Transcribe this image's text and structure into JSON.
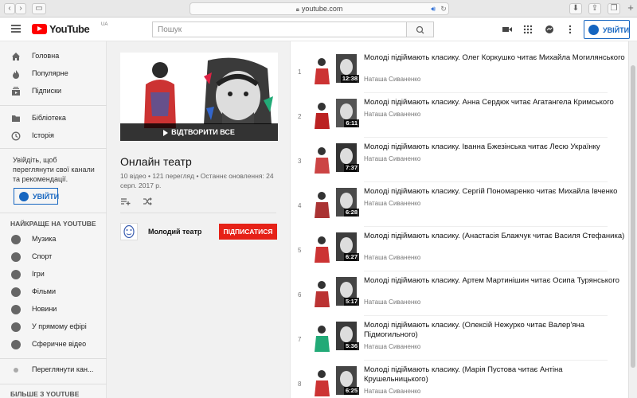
{
  "browser": {
    "url": "youtube.com",
    "new_tab": "+"
  },
  "masthead": {
    "logo_text": "YouTube",
    "logo_region": "UA",
    "search_placeholder": "Пошук",
    "signin_label": "УВІЙТИ"
  },
  "sidebar": {
    "primary": [
      {
        "label": "Головна",
        "icon": "home-icon"
      },
      {
        "label": "Популярне",
        "icon": "flame-icon"
      },
      {
        "label": "Підписки",
        "icon": "subscriptions-icon"
      }
    ],
    "library": [
      {
        "label": "Бібліотека",
        "icon": "folder-icon"
      },
      {
        "label": "Історія",
        "icon": "history-icon"
      }
    ],
    "signin_note": "Увійдіть, щоб переглянути свої канали та рекомендації.",
    "signin_label": "УВІЙТИ",
    "best_heading": "НАЙКРАЩЕ НА YOUTUBE",
    "best": [
      {
        "label": "Музика",
        "icon": "music-icon"
      },
      {
        "label": "Спорт",
        "icon": "sport-icon"
      },
      {
        "label": "Ігри",
        "icon": "games-icon"
      },
      {
        "label": "Фільми",
        "icon": "film-icon"
      },
      {
        "label": "Новини",
        "icon": "news-icon"
      },
      {
        "label": "У прямому ефірі",
        "icon": "live-icon"
      },
      {
        "label": "Сферичне відео",
        "icon": "spherical-icon"
      }
    ],
    "browse_channels": "Переглянути кан...",
    "more_heading": "БІЛЬШЕ З YOUTUBE"
  },
  "playlist": {
    "play_all": "ВІДТВОРИТИ ВСЕ",
    "title": "Онлайн театр",
    "meta": "10 відео • 121 перегляд • Останнє оновлення: 24 серп. 2017 р.",
    "owner": "Молодий театр",
    "subscribe": "ПІДПИСАТИСЯ"
  },
  "videos": [
    {
      "index": "1",
      "title": "Молоді підіймають класику. Олег Коркушко читає Михайла Могилянського",
      "channel": "Наташа Сиваненко",
      "duration": "12:38"
    },
    {
      "index": "2",
      "title": "Молоді підіймають класику. Анна Сердюк читає Агатангела Кримського",
      "channel": "Наташа Сиваненко",
      "duration": "6:11"
    },
    {
      "index": "3",
      "title": "Молоді підіймають класику. Іванна Бжезінська читає Лесю Українку",
      "channel": "Наташа Сиваненко",
      "duration": "7:37"
    },
    {
      "index": "4",
      "title": "Молоді підіймають класику. Сергій Пономаренко читає Михайла Івченко",
      "channel": "Наташа Сиваненко",
      "duration": "6:28"
    },
    {
      "index": "5",
      "title": "Молоді підіймають класику. (Анастасія Блажчук читає Василя Стефаника)",
      "channel": "Наташа Сиваненко",
      "duration": "6:27"
    },
    {
      "index": "6",
      "title": "Молоді підіймають класику. Артем Мартинішин читає Осипа Турянського",
      "channel": "Наташа Сиваненко",
      "duration": "5:17"
    },
    {
      "index": "7",
      "title": "Молоді підіймають класику. (Олексій Нежурко читає Валер'яна Підмогильного)",
      "channel": "Наташа Сиваненко",
      "duration": "5:36"
    },
    {
      "index": "8",
      "title": "Молоді підіймають класику. (Марія Пустова читає Антіна Крушельницького)",
      "channel": "Наташа Сиваненко",
      "duration": "6:25"
    }
  ]
}
